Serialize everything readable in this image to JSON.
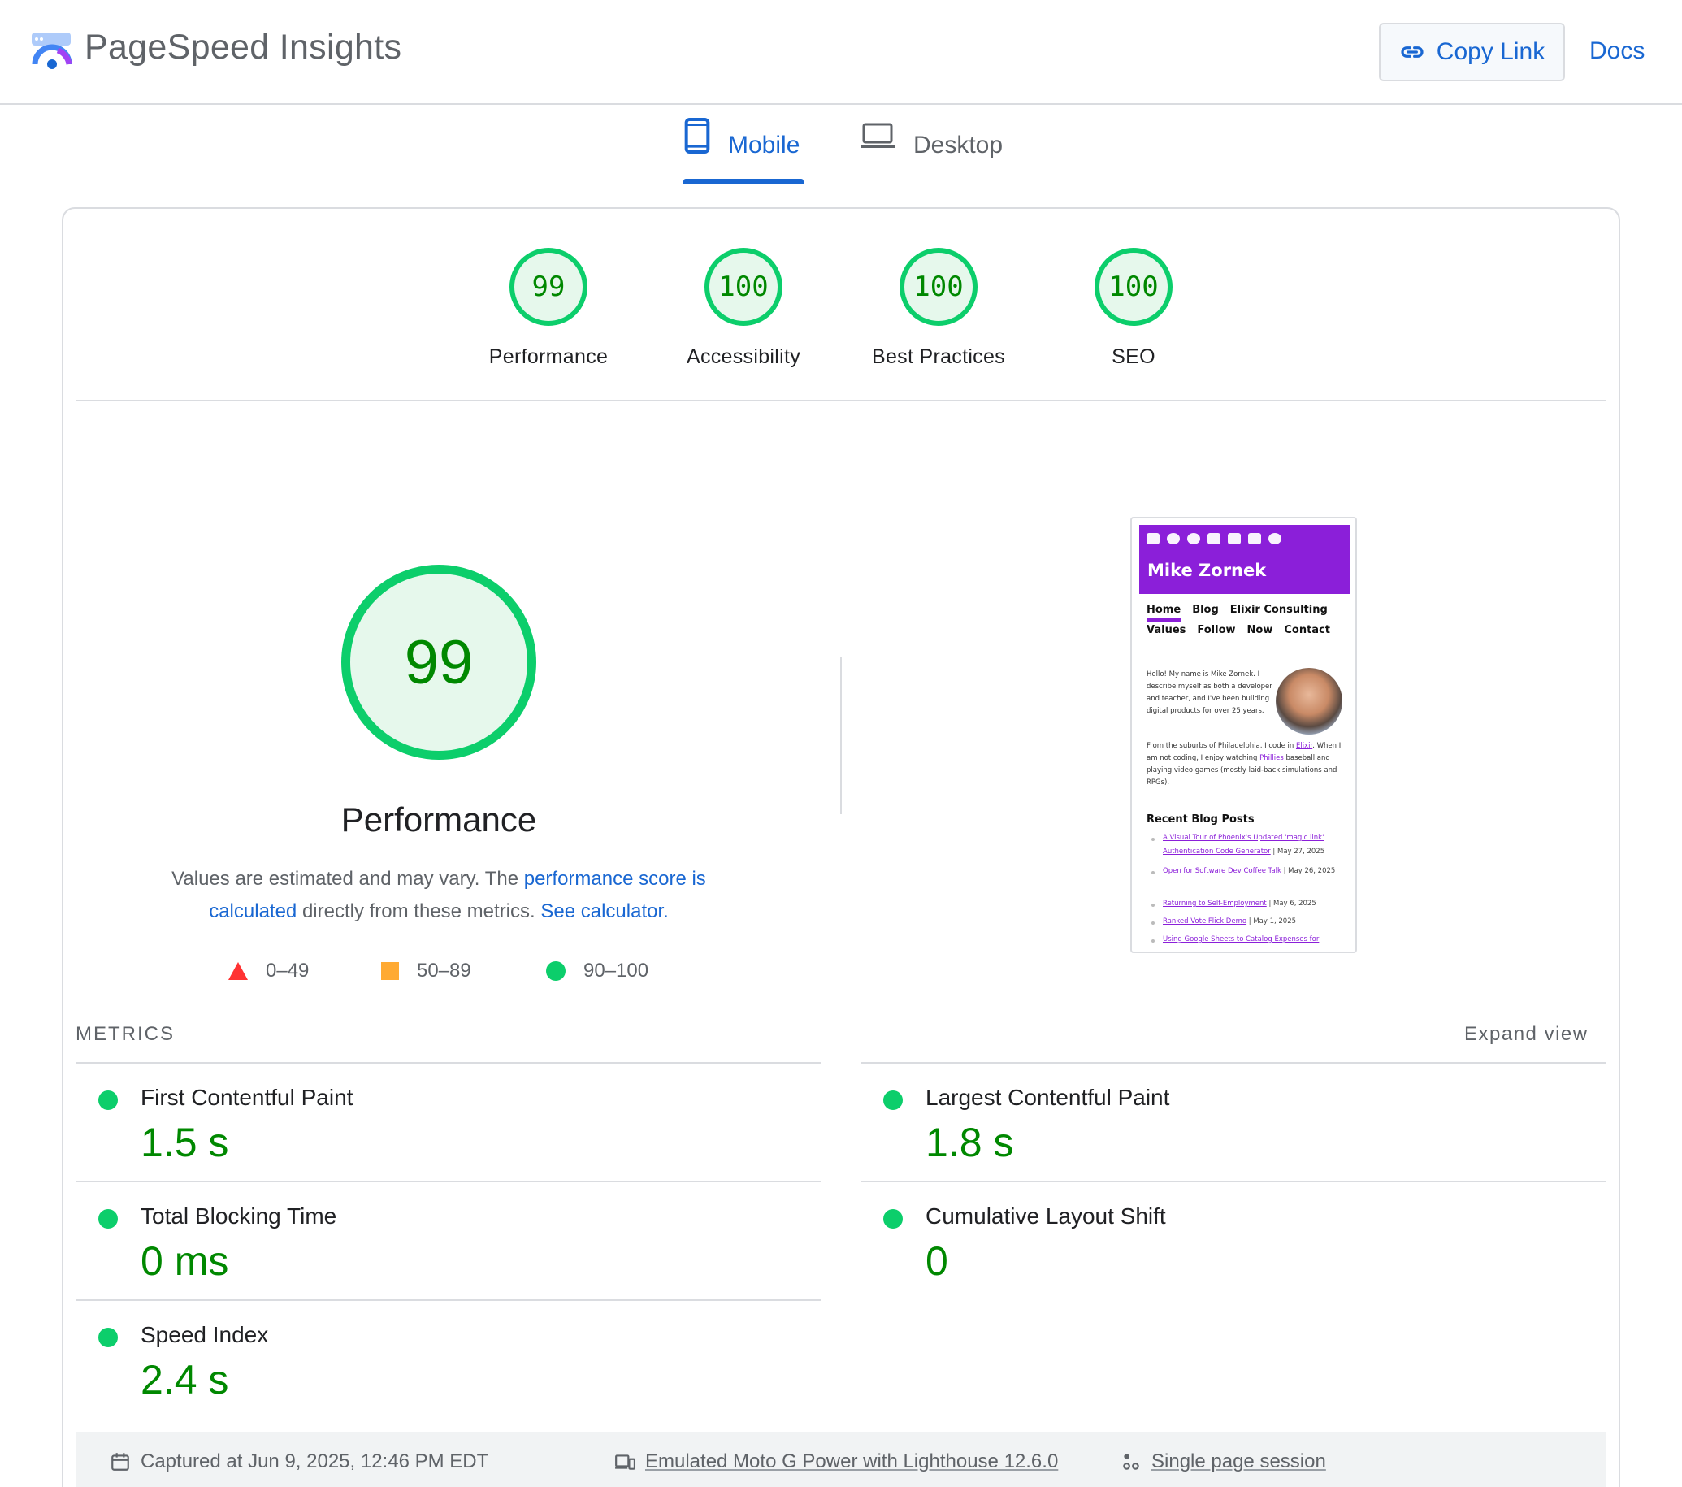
{
  "header": {
    "app_title": "PageSpeed Insights",
    "copy_link_label": "Copy Link",
    "docs_label": "Docs",
    "logo_icon": "pagespeed-logo-icon",
    "accent_color": "#1967d2"
  },
  "tabs": [
    {
      "label": "Mobile",
      "icon": "phone-icon",
      "selected": true
    },
    {
      "label": "Desktop",
      "icon": "laptop-icon",
      "selected": false
    }
  ],
  "scores": [
    {
      "value": "99",
      "label": "Performance"
    },
    {
      "value": "100",
      "label": "Accessibility"
    },
    {
      "value": "100",
      "label": "Best Practices"
    },
    {
      "value": "100",
      "label": "SEO"
    }
  ],
  "performance": {
    "score": "99",
    "title": "Performance",
    "desc_prefix": "Values are estimated and may vary. The ",
    "desc_link1": "performance score is calculated",
    "desc_middle": " directly from these metrics. ",
    "desc_link2": "See calculator.",
    "pass_color": "#0cce6b",
    "average_color": "#ffaa33",
    "fail_color": "#ff3333"
  },
  "legend": [
    {
      "range": "0–49",
      "shape": "triangle"
    },
    {
      "range": "50–89",
      "shape": "square"
    },
    {
      "range": "90–100",
      "shape": "circle"
    }
  ],
  "thumbnail": {
    "site_name": "Mike Zornek",
    "nav_row1": [
      "Home",
      "Blog",
      "Elixir Consulting"
    ],
    "nav_row2": [
      "Values",
      "Follow",
      "Now",
      "Contact"
    ],
    "intro": "Hello! My name is Mike Zornek. I describe myself as both a developer and teacher, and I've been building digital products for over 25 years.",
    "para_part1": "From the suburbs of Philadelphia, I code in ",
    "para_link1": "Elixir",
    "para_part2": ". When I am not coding, I enjoy watching ",
    "para_link2": "Phillies",
    "para_part3": " baseball and playing video games (mostly laid-back simulations and RPGs).",
    "recent_heading": "Recent Blog Posts",
    "posts": [
      {
        "title": "A Visual Tour of Phoenix's Updated 'magic link' Authentication Code Generator",
        "date": " | May 27, 2025"
      },
      {
        "title": "Open for Software Dev Coffee Talk",
        "date": " | May 26, 2025"
      },
      {
        "title": "Returning to Self-Employment",
        "date": " | May 6, 2025"
      },
      {
        "title": "Ranked Vote Flick Demo",
        "date": " | May 1, 2025"
      },
      {
        "title": "Using Google Sheets to Catalog Expenses for",
        "date": ""
      }
    ]
  },
  "metrics": {
    "heading": "METRICS",
    "expand_label": "Expand view",
    "items": [
      {
        "label": "First Contentful Paint",
        "value": "1.5 s"
      },
      {
        "label": "Largest Contentful Paint",
        "value": "1.8 s"
      },
      {
        "label": "Total Blocking Time",
        "value": "0 ms"
      },
      {
        "label": "Cumulative Layout Shift",
        "value": "0"
      },
      {
        "label": "Speed Index",
        "value": "2.4 s"
      }
    ]
  },
  "footer": {
    "captured": "Captured at Jun 9, 2025, 12:46 PM EDT",
    "device": "Emulated Moto G Power with Lighthouse 12.6.0",
    "session": "Single page session"
  }
}
